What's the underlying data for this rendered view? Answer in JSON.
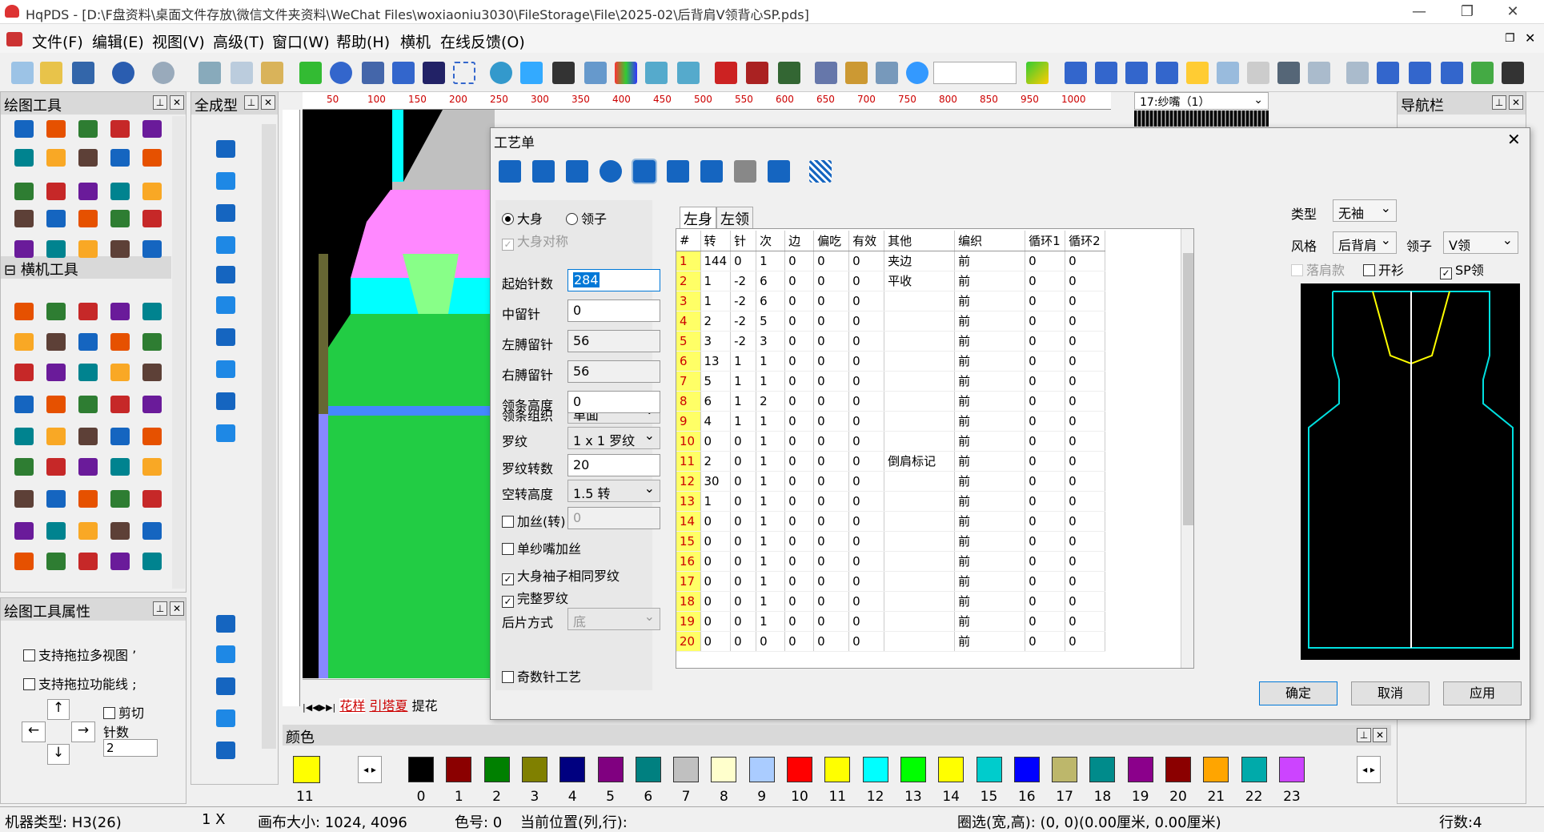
{
  "app": {
    "title": "HqPDS - [D:\\F盘资料\\桌面文件存放\\微信文件夹资料\\WeChat Files\\woxiaoniu3030\\FileStorage\\File\\2025-02\\后背肩V领背心SP.pds]"
  },
  "menu": [
    "文件(F)",
    "编辑(E)",
    "视图(V)",
    "高级(T)",
    "窗口(W)",
    "帮助(H)",
    "横机",
    "在线反馈(O)"
  ],
  "panels": {
    "draw_tools": "绘图工具",
    "knit_tools": "横机工具",
    "draw_props": "绘图工具属性",
    "full_shape": "全成型",
    "navigator": "导航栏",
    "color": "颜色"
  },
  "props": {
    "multi_view": "支持拖拉多视图",
    "func_line": "支持拖拉功能线",
    "cut": "剪切",
    "needles_label": "针数",
    "needles_value": "2"
  },
  "ruler": [
    "50",
    "100",
    "150",
    "200",
    "250",
    "300",
    "350",
    "400",
    "450",
    "500",
    "550",
    "600",
    "650",
    "700",
    "750",
    "800",
    "850",
    "950",
    "1000"
  ],
  "yarn_select": "17:纱嘴（1）",
  "canvas_tabs": [
    "花样",
    "引塔夏",
    "提花"
  ],
  "dialog": {
    "title": "工艺单",
    "radio_body": "大身",
    "radio_collar": "领子",
    "symmetric": "大身对称",
    "fields": [
      {
        "label": "起始针数",
        "value": "284"
      },
      {
        "label": "中留针",
        "value": "0"
      },
      {
        "label": "左膊留针",
        "value": "56"
      },
      {
        "label": "右膊留针",
        "value": "56"
      },
      {
        "label": "领条高度",
        "value": "0"
      }
    ],
    "collar_knit_label": "领条组织",
    "collar_knit_value": "单面",
    "rib_label": "罗纹",
    "rib_value": "1 x 1 罗纹",
    "rib_turns_label": "罗纹转数",
    "rib_turns_value": "20",
    "empty_label": "空转高度",
    "empty_value": "1.5 转",
    "add_yarn": "加丝(转)",
    "add_yarn_value": "0",
    "single_yarn": "单纱嘴加丝",
    "same_rib": "大身袖子相同罗纹",
    "full_rib": "完整罗纹",
    "back_label": "后片方式",
    "back_value": "底",
    "odd_needle": "奇数针工艺",
    "tabs": [
      "左身",
      "左领"
    ],
    "columns": [
      "#",
      "转",
      "针",
      "次",
      "边",
      "偏吃",
      "有效",
      "其他",
      "编织",
      "循环1",
      "循环2"
    ],
    "rows": [
      [
        "1",
        "144",
        "0",
        "1",
        "0",
        "0",
        "0",
        "夹边",
        "前",
        "0",
        "0"
      ],
      [
        "2",
        "1",
        "-2",
        "6",
        "0",
        "0",
        "0",
        "平收",
        "前",
        "0",
        "0"
      ],
      [
        "3",
        "1",
        "-2",
        "6",
        "0",
        "0",
        "0",
        "",
        "前",
        "0",
        "0"
      ],
      [
        "4",
        "2",
        "-2",
        "5",
        "0",
        "0",
        "0",
        "",
        "前",
        "0",
        "0"
      ],
      [
        "5",
        "3",
        "-2",
        "3",
        "0",
        "0",
        "0",
        "",
        "前",
        "0",
        "0"
      ],
      [
        "6",
        "13",
        "1",
        "1",
        "0",
        "0",
        "0",
        "",
        "前",
        "0",
        "0"
      ],
      [
        "7",
        "5",
        "1",
        "1",
        "0",
        "0",
        "0",
        "",
        "前",
        "0",
        "0"
      ],
      [
        "8",
        "6",
        "1",
        "2",
        "0",
        "0",
        "0",
        "",
        "前",
        "0",
        "0"
      ],
      [
        "9",
        "4",
        "1",
        "1",
        "0",
        "0",
        "0",
        "",
        "前",
        "0",
        "0"
      ],
      [
        "10",
        "0",
        "0",
        "1",
        "0",
        "0",
        "0",
        "",
        "前",
        "0",
        "0"
      ],
      [
        "11",
        "2",
        "0",
        "1",
        "0",
        "0",
        "0",
        "倒肩标记",
        "前",
        "0",
        "0"
      ],
      [
        "12",
        "30",
        "0",
        "1",
        "0",
        "0",
        "0",
        "",
        "前",
        "0",
        "0"
      ],
      [
        "13",
        "1",
        "0",
        "1",
        "0",
        "0",
        "0",
        "",
        "前",
        "0",
        "0"
      ],
      [
        "14",
        "0",
        "0",
        "1",
        "0",
        "0",
        "0",
        "",
        "前",
        "0",
        "0"
      ],
      [
        "15",
        "0",
        "0",
        "1",
        "0",
        "0",
        "0",
        "",
        "前",
        "0",
        "0"
      ],
      [
        "16",
        "0",
        "0",
        "1",
        "0",
        "0",
        "0",
        "",
        "前",
        "0",
        "0"
      ],
      [
        "17",
        "0",
        "0",
        "1",
        "0",
        "0",
        "0",
        "",
        "前",
        "0",
        "0"
      ],
      [
        "18",
        "0",
        "0",
        "1",
        "0",
        "0",
        "0",
        "",
        "前",
        "0",
        "0"
      ],
      [
        "19",
        "0",
        "0",
        "1",
        "0",
        "0",
        "0",
        "",
        "前",
        "0",
        "0"
      ],
      [
        "20",
        "0",
        "0",
        "0",
        "0",
        "0",
        "0",
        "",
        "前",
        "0",
        "0"
      ]
    ],
    "type_label": "类型",
    "type_value": "无袖",
    "style_label": "风格",
    "style_value": "后背肩",
    "collar_label": "领子",
    "collar_value": "V领",
    "drop_shoulder": "落肩款",
    "cardigan": "开衫",
    "sp_collar": "SP领",
    "ok": "确定",
    "cancel": "取消",
    "apply": "应用"
  },
  "swatches": [
    {
      "n": "0",
      "c": "#000000"
    },
    {
      "n": "1",
      "c": "#8b0000"
    },
    {
      "n": "2",
      "c": "#008000"
    },
    {
      "n": "3",
      "c": "#808000"
    },
    {
      "n": "4",
      "c": "#000080"
    },
    {
      "n": "5",
      "c": "#800080"
    },
    {
      "n": "6",
      "c": "#008080"
    },
    {
      "n": "7",
      "c": "#c0c0c0"
    },
    {
      "n": "8",
      "c": "#ffffcc"
    },
    {
      "n": "9",
      "c": "#aaccff"
    },
    {
      "n": "10",
      "c": "#ff0000"
    },
    {
      "n": "11",
      "c": "#ffff00"
    },
    {
      "n": "12",
      "c": "#00ffff"
    },
    {
      "n": "13",
      "c": "#00ff00"
    },
    {
      "n": "14",
      "c": "#ffff00"
    },
    {
      "n": "15",
      "c": "#00cccc"
    },
    {
      "n": "16",
      "c": "#0000ff"
    },
    {
      "n": "17",
      "c": "#bdb76b"
    },
    {
      "n": "18",
      "c": "#008b8b"
    },
    {
      "n": "19",
      "c": "#8b008b"
    },
    {
      "n": "20",
      "c": "#8b0000"
    },
    {
      "n": "21",
      "c": "#ffa500"
    },
    {
      "n": "22",
      "c": "#00aaaa"
    },
    {
      "n": "23",
      "c": "#cc44ff"
    }
  ],
  "current_color": "11",
  "status": {
    "machine": "机器类型: H3(26)",
    "zoom": "1 X",
    "canvas": "画布大小: 1024, 4096",
    "color": "色号: 0",
    "pos": "当前位置(列,行):",
    "sel": "圈选(宽,高): (0, 0)(0.00厘米, 0.00厘米)",
    "rows": "行数:4"
  }
}
